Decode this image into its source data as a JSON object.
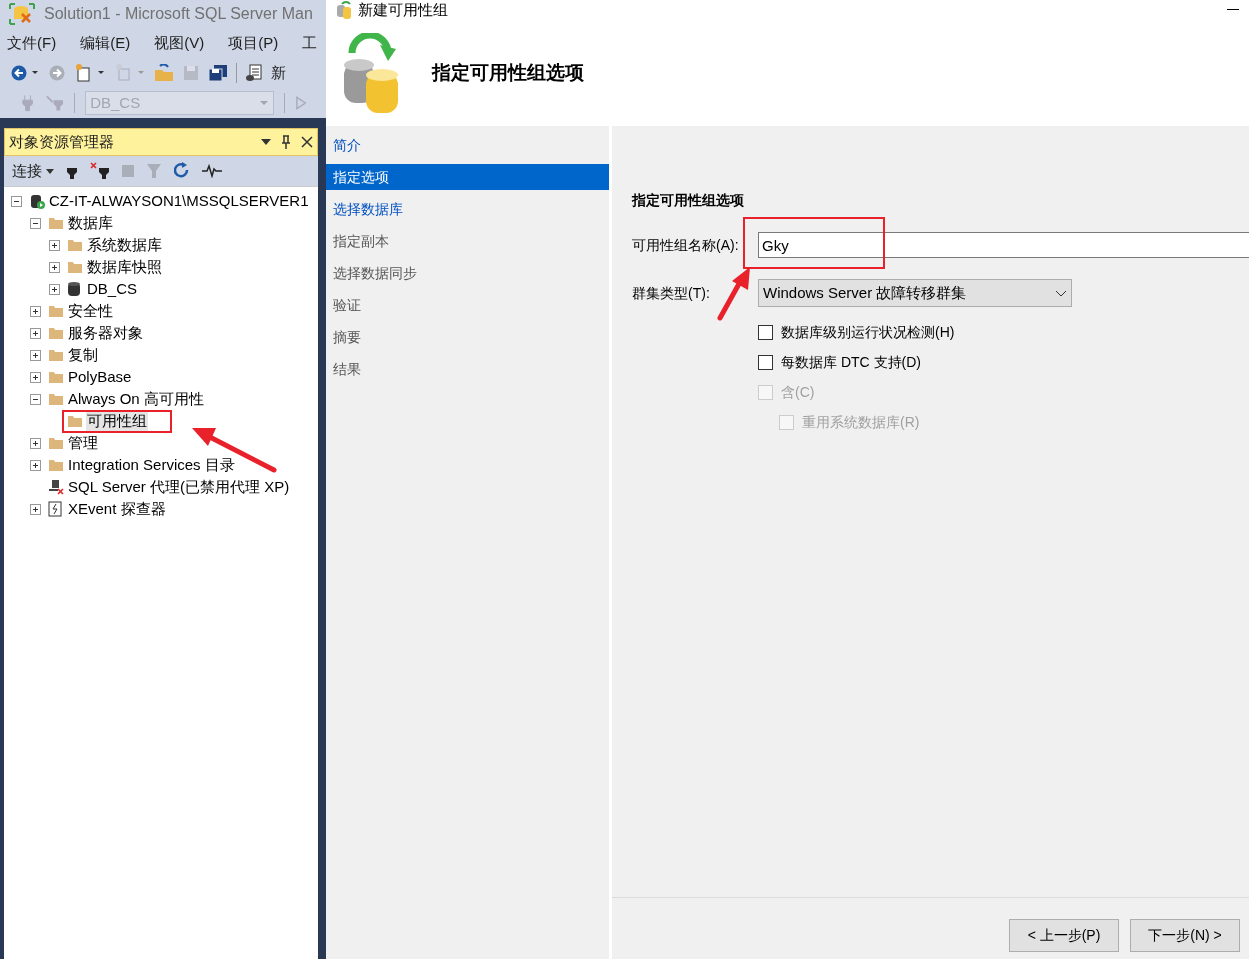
{
  "main_window": {
    "title": "Solution1 - Microsoft SQL Server Man",
    "menu": [
      "文件(F)",
      "编辑(E)",
      "视图(V)",
      "项目(P)",
      "工"
    ],
    "toolbar_text": "新",
    "database_select": "DB_CS"
  },
  "object_explorer": {
    "title": "对象资源管理器",
    "connect": "连接",
    "tree": [
      {
        "label": "CZ-IT-ALWAYSON1\\MSSQLSERVER1",
        "kind": "server",
        "expanded": true,
        "selected": false,
        "children": [
          {
            "label": "数据库",
            "kind": "folder",
            "expanded": true,
            "selected": false,
            "children": [
              {
                "label": "系统数据库",
                "kind": "folder",
                "expanded": false,
                "selected": false
              },
              {
                "label": "数据库快照",
                "kind": "folder",
                "expanded": false,
                "selected": false
              },
              {
                "label": "DB_CS",
                "kind": "database",
                "expanded": false,
                "selected": false
              }
            ]
          },
          {
            "label": "安全性",
            "kind": "folder",
            "expanded": false,
            "selected": false
          },
          {
            "label": "服务器对象",
            "kind": "folder",
            "expanded": false,
            "selected": false
          },
          {
            "label": "复制",
            "kind": "folder",
            "expanded": false,
            "selected": false
          },
          {
            "label": "PolyBase",
            "kind": "folder",
            "expanded": false,
            "selected": false
          },
          {
            "label": "Always On 高可用性",
            "kind": "folder",
            "expanded": true,
            "selected": false,
            "children": [
              {
                "label": "可用性组",
                "kind": "folder",
                "selected": true
              }
            ]
          },
          {
            "label": "管理",
            "kind": "folder",
            "expanded": false,
            "selected": false
          },
          {
            "label": "Integration Services 目录",
            "kind": "folder",
            "expanded": false,
            "selected": false
          },
          {
            "label": "SQL Server 代理(已禁用代理 XP)",
            "kind": "agent",
            "selected": false
          },
          {
            "label": "XEvent 探查器",
            "kind": "xevent",
            "expanded": false,
            "selected": false
          }
        ]
      }
    ]
  },
  "dialog": {
    "title": "新建可用性组",
    "header": "指定可用性组选项",
    "nav": [
      {
        "label": "简介",
        "selected": false,
        "enabled": true
      },
      {
        "label": "指定选项",
        "selected": true,
        "enabled": true
      },
      {
        "label": "选择数据库",
        "selected": false,
        "enabled": true
      },
      {
        "label": "指定副本",
        "selected": false,
        "enabled": false
      },
      {
        "label": "选择数据同步",
        "selected": false,
        "enabled": false
      },
      {
        "label": "验证",
        "selected": false,
        "enabled": false
      },
      {
        "label": "摘要",
        "selected": false,
        "enabled": false
      },
      {
        "label": "结果",
        "selected": false,
        "enabled": false
      }
    ],
    "section_title": "指定可用性组选项",
    "name_label": "可用性组名称(A):",
    "name_value": "Gky",
    "cluster_label": "群集类型(T):",
    "cluster_value": "Windows Server 故障转移群集",
    "options": [
      {
        "label": "数据库级别运行状况检测(H)",
        "checked": false,
        "disabled": false,
        "indent": false
      },
      {
        "label": "每数据库 DTC 支持(D)",
        "checked": false,
        "disabled": false,
        "indent": false
      },
      {
        "label": "含(C)",
        "checked": false,
        "disabled": true,
        "indent": false
      },
      {
        "label": "重用系统数据库(R)",
        "checked": false,
        "disabled": true,
        "indent": true
      }
    ],
    "buttons": [
      "< 上一步(P)",
      "下一步(N) >"
    ]
  }
}
